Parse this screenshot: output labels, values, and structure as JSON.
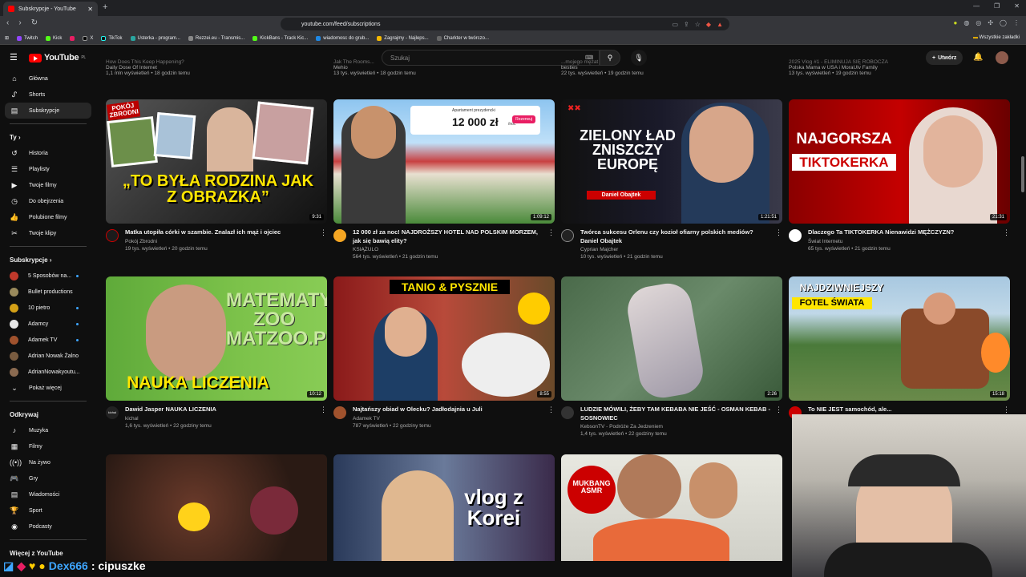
{
  "browser": {
    "tab_title": "Subskrypcje - YouTube",
    "url": "youtube.com/feed/subscriptions",
    "bookmarks": [
      "Twitch",
      "Kick",
      "X",
      "TikTok",
      "Usterka - program...",
      "Rezzei.eu - Transmis...",
      "KickBans - Track Kic...",
      "wiadomosc do grub...",
      "Zagrajmy - Najleps...",
      "Charkter w twórczo..."
    ],
    "bookmarks_right": "Wszystkie zakładki"
  },
  "header": {
    "logo_text": "YouTube",
    "logo_region": "PL",
    "search_placeholder": "Szukaj",
    "create_label": "Utwórz"
  },
  "sidebar": {
    "main": [
      {
        "label": "Główna",
        "icon": "home-icon"
      },
      {
        "label": "Shorts",
        "icon": "shorts-icon"
      },
      {
        "label": "Subskrypcje",
        "icon": "subscriptions-icon",
        "active": true
      }
    ],
    "you_heading": "Ty",
    "you": [
      {
        "label": "Historia",
        "icon": "history-icon"
      },
      {
        "label": "Playlisty",
        "icon": "playlist-icon"
      },
      {
        "label": "Twoje filmy",
        "icon": "video-icon"
      },
      {
        "label": "Do obejrzenia",
        "icon": "clock-icon"
      },
      {
        "label": "Polubione filmy",
        "icon": "thumbs-up-icon"
      },
      {
        "label": "Twoje klipy",
        "icon": "scissors-icon"
      }
    ],
    "subs_heading": "Subskrypcje",
    "subs": [
      {
        "label": "5 Sposobów na...",
        "color": "#c0392b",
        "live": true
      },
      {
        "label": "Bullet productions",
        "color": "#9a8a5c",
        "live": false
      },
      {
        "label": "10 pietro",
        "color": "#d4a017",
        "live": true
      },
      {
        "label": "Adamcy",
        "color": "#e8e8e8",
        "live": true
      },
      {
        "label": "Adamek TV",
        "color": "#a0522d",
        "live": true
      },
      {
        "label": "Adrian Nowak Żalno",
        "color": "#7a5c40",
        "live": false
      },
      {
        "label": "AdrianNowakyoutu...",
        "color": "#8a6a50",
        "live": false
      }
    ],
    "show_more": "Pokaż więcej",
    "explore_heading": "Odkrywaj",
    "explore": [
      {
        "label": "Muzyka",
        "icon": "music-icon"
      },
      {
        "label": "Filmy",
        "icon": "film-icon"
      },
      {
        "label": "Na żywo",
        "icon": "live-icon"
      },
      {
        "label": "Gry",
        "icon": "gamepad-icon"
      },
      {
        "label": "Wiadomości",
        "icon": "news-icon"
      },
      {
        "label": "Sport",
        "icon": "trophy-icon"
      },
      {
        "label": "Podcasty",
        "icon": "podcast-icon"
      }
    ],
    "more_heading": "Więcej z YouTube"
  },
  "top_partial": [
    {
      "title": "How Does This Keep Happening?",
      "channel": "Daily Dose Of Internet",
      "stats": "1,1 mln wyświetleń • 18 godzin temu"
    },
    {
      "title": "Jak The Rooms...",
      "channel": "Mehio",
      "stats": "13 tys. wyświetleń • 18 godzin temu"
    },
    {
      "title": "...mojego mężat",
      "channel": "besties",
      "stats": "22 tys. wyświetleń • 19 godzin temu"
    },
    {
      "title": "2025 Vlog #1 - ELIMINUJA SIĘ ROBOCZA",
      "channel": "Polska Mama w USA i MoraUlv Family",
      "stats": "13 tys. wyświetleń • 19 godzin temu"
    }
  ],
  "videos": [
    {
      "title": "Matka utopiła córki w szambie. Znalazł ich mąż i ojciec",
      "channel": "Pokój Zbrodni",
      "stats": "19 tys. wyświetleń • 20 godzin temu",
      "duration": "9:31",
      "thumb_text": "„TO BYŁA RODZINA JAK Z OBRAZKA”",
      "thumb_label": "POKÓJ ZBRODNI"
    },
    {
      "title": "12 000 zł za noc! NAJDROŻSZY HOTEL NAD POLSKIM MORZEM, jak się bawią elity?",
      "channel": "KSIĄŻULO",
      "stats": "564 tys. wyświetleń • 21 godzin temu",
      "duration": "1:09:12",
      "thumb_text": "12 000 zł",
      "thumb_label": "Apartament prezydencki",
      "thumb_button": "Rezerwuj",
      "thumb_unit": "/noc"
    },
    {
      "title": "Twórca sukcesu Orlenu czy kozioł ofiarny polskich mediów? Daniel Obajtek",
      "channel": "Cyprian Majcher",
      "stats": "10 tys. wyświetleń • 21 godzin temu",
      "duration": "1:21:51",
      "thumb_text": "ZIELONY ŁAD ZNISZCZY EUROPĘ",
      "thumb_label": "Daniel Obajtek"
    },
    {
      "title": "Dlaczego Ta TIKTOKERKA Nienawidzi MĘŻCZYZN?",
      "channel": "Świat Internetu",
      "stats": "65 tys. wyświetleń • 21 godzin temu",
      "duration": "21:31",
      "thumb_text": "NAJGORSZA",
      "thumb_label": "TIKTOKERKA"
    },
    {
      "title": "Dawid Jasper NAUKA LICZENIA",
      "channel": "kichal",
      "stats": "1,6 tys. wyświetleń • 22 godziny temu",
      "duration": "10:12",
      "thumb_text": "NAUKA LICZENIA",
      "thumb_label": "MATEMATYCZNE ZOO MATZOO.PL"
    },
    {
      "title": "Najtańszy obiad w Olecku? Jadłodajnia u Juli",
      "channel": "Adamek TV",
      "stats": "787 wyświetleń • 22 godziny temu",
      "duration": "8:55",
      "thumb_text": "TANIO & PYSZNIE",
      "thumb_label": ""
    },
    {
      "title": "LUDZIE MÓWILI, ŻEBY TAM KEBABA NIE JEŚĆ - OSMAN KEBAB - SOSNOWIEC",
      "channel": "KebsonTV - Podróże Za Jedzeniem",
      "stats": "1,4 tys. wyświetleń • 22 godziny temu",
      "duration": "2:26",
      "thumb_text": "",
      "thumb_label": ""
    },
    {
      "title": "To NIE JEST samochód, ale...",
      "channel": "",
      "stats": "",
      "duration": "15:18",
      "thumb_text": "NAJDZIWNIEJSZY",
      "thumb_label": "FOTEL ŚWIATA"
    },
    {
      "title": "",
      "channel": "",
      "stats": "",
      "duration": "",
      "thumb_text": "",
      "thumb_label": ""
    },
    {
      "title": "",
      "channel": "",
      "stats": "",
      "duration": "",
      "thumb_text": "vlog z Korei",
      "thumb_label": ""
    },
    {
      "title": "",
      "channel": "",
      "stats": "",
      "duration": "",
      "thumb_text": "MUKBANG ASMR",
      "thumb_label": ""
    }
  ],
  "stream_overlay": {
    "user": "Dex666",
    "message": ": cipuszke"
  },
  "colors": {
    "bg": "#0f0f0f",
    "accent": "#ff0000",
    "link": "#3ea6ff"
  }
}
